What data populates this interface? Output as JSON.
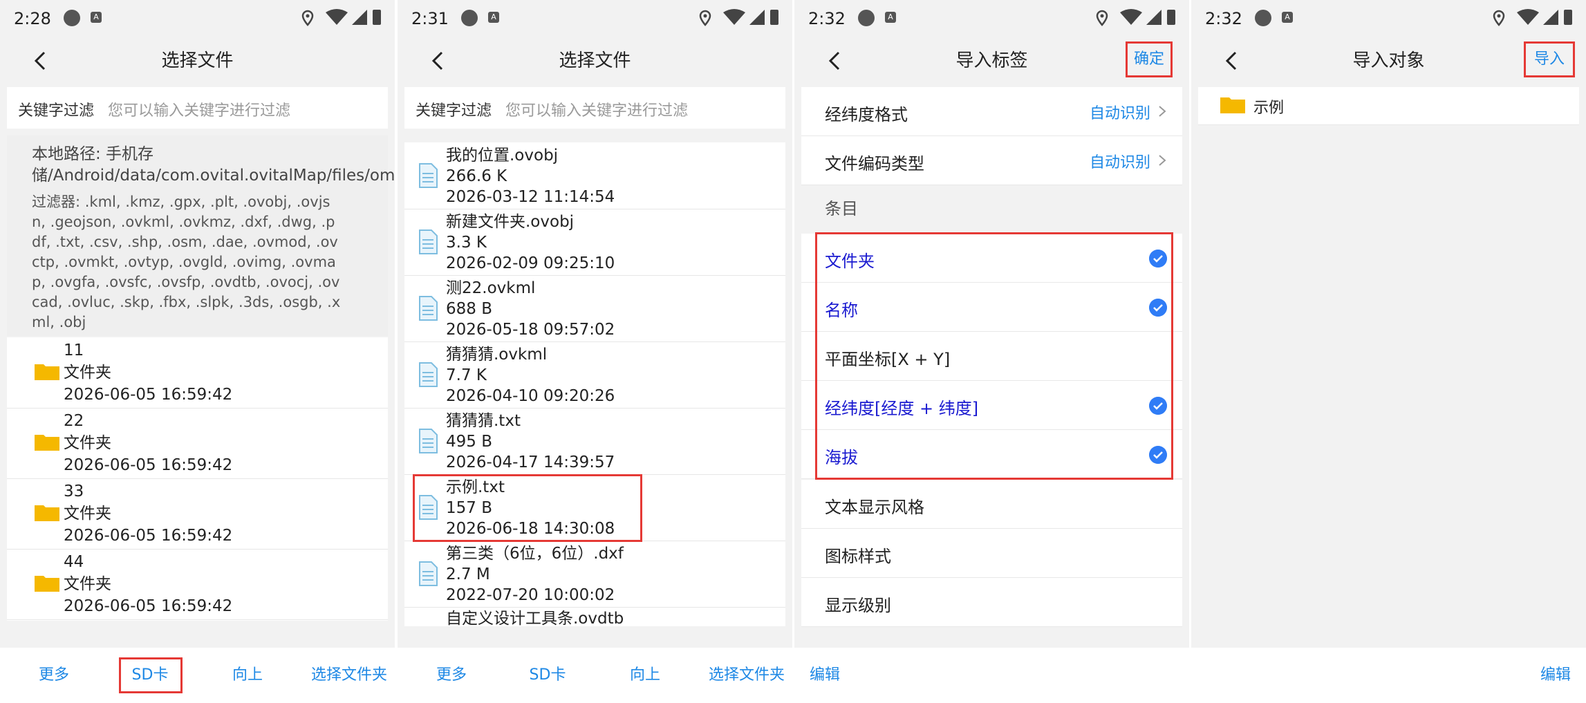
{
  "panel1": {
    "status": {
      "time": "2:28"
    },
    "title": "选择文件",
    "filter": {
      "label": "关键字过滤",
      "placeholder": "您可以输入关键字进行过滤"
    },
    "path": "本地路径: 手机存储/Android/data/com.ovital.ovitalMap/files/omap",
    "filters": "过滤器: .kml, .kmz, .gpx, .plt, .ovobj, .ovjsn, .geojson, .ovkml, .ovkmz, .dxf, .dwg, .pdf, .txt, .csv, .shp, .osm, .dae, .ovmod, .ovctp, .ovmkt, .ovtyp, .ovgld, .ovimg, .ovmap, .ovgfa, .ovsfc, .ovsfp, .ovdtb, .ovocj, .ovcad, .ovluc, .skp, .fbx, .slpk, .3ds, .osgb, .xml, .obj",
    "items": [
      {
        "name": "11",
        "type": "文件夹",
        "date": "2026-06-05 16:59:42"
      },
      {
        "name": "22",
        "type": "文件夹",
        "date": "2026-06-05 16:59:42"
      },
      {
        "name": "33",
        "type": "文件夹",
        "date": "2026-06-05 16:59:42"
      },
      {
        "name": "44",
        "type": "文件夹",
        "date": "2026-06-05 16:59:42"
      }
    ],
    "bottom": {
      "more": "更多",
      "sd": "SD卡",
      "up": "向上",
      "select_folder": "选择文件夹"
    }
  },
  "panel2": {
    "status": {
      "time": "2:31"
    },
    "title": "选择文件",
    "filter": {
      "label": "关键字过滤",
      "placeholder": "您可以输入关键字进行过滤"
    },
    "files": [
      {
        "name": "我的位置.ovobj",
        "size": "266.6 K",
        "date": "2026-03-12 11:14:54"
      },
      {
        "name": "新建文件夹.ovobj",
        "size": "3.3 K",
        "date": "2026-02-09 09:25:10"
      },
      {
        "name": "测22.ovkml",
        "size": "688 B",
        "date": "2026-05-18 09:57:02"
      },
      {
        "name": "猜猜猜.ovkml",
        "size": "7.7 K",
        "date": "2026-04-10 09:20:26"
      },
      {
        "name": "猜猜猜.txt",
        "size": "495 B",
        "date": "2026-04-17 14:39:57"
      },
      {
        "name": "示例.txt",
        "size": "157 B",
        "date": "2026-06-18 14:30:08"
      },
      {
        "name": "第三类（6位，6位）.dxf",
        "size": "2.7 M",
        "date": "2022-07-20 10:00:02"
      },
      {
        "name": "自定义设计工具条.ovdtb",
        "size": "",
        "date": ""
      }
    ],
    "bottom": {
      "more": "更多",
      "sd": "SD卡",
      "up": "向上",
      "select_folder": "选择文件夹"
    }
  },
  "panel3": {
    "status": {
      "time": "2:32"
    },
    "title": "导入标签",
    "confirm": "确定",
    "coord_format": {
      "label": "经纬度格式",
      "value": "自动识别"
    },
    "encoding": {
      "label": "文件编码类型",
      "value": "自动识别"
    },
    "section": "条目",
    "entries": [
      {
        "label": "文件夹",
        "checked": true
      },
      {
        "label": "名称",
        "checked": true
      },
      {
        "label": "平面坐标[X + Y]",
        "checked": false
      },
      {
        "label": "经纬度[经度 + 纬度]",
        "checked": true
      },
      {
        "label": "海拔",
        "checked": true
      }
    ],
    "styles": [
      {
        "label": "文本显示风格"
      },
      {
        "label": "图标样式"
      },
      {
        "label": "显示级别"
      }
    ],
    "edit": "编辑"
  },
  "panel4": {
    "status": {
      "time": "2:32"
    },
    "title": "导入对象",
    "import": "导入",
    "items": [
      {
        "label": "示例"
      }
    ],
    "edit": "编辑"
  },
  "colors": {
    "accent": "#1e88e5",
    "highlight": "#e53935",
    "checked": "#2f7cf6",
    "folder": "#f5b800"
  }
}
